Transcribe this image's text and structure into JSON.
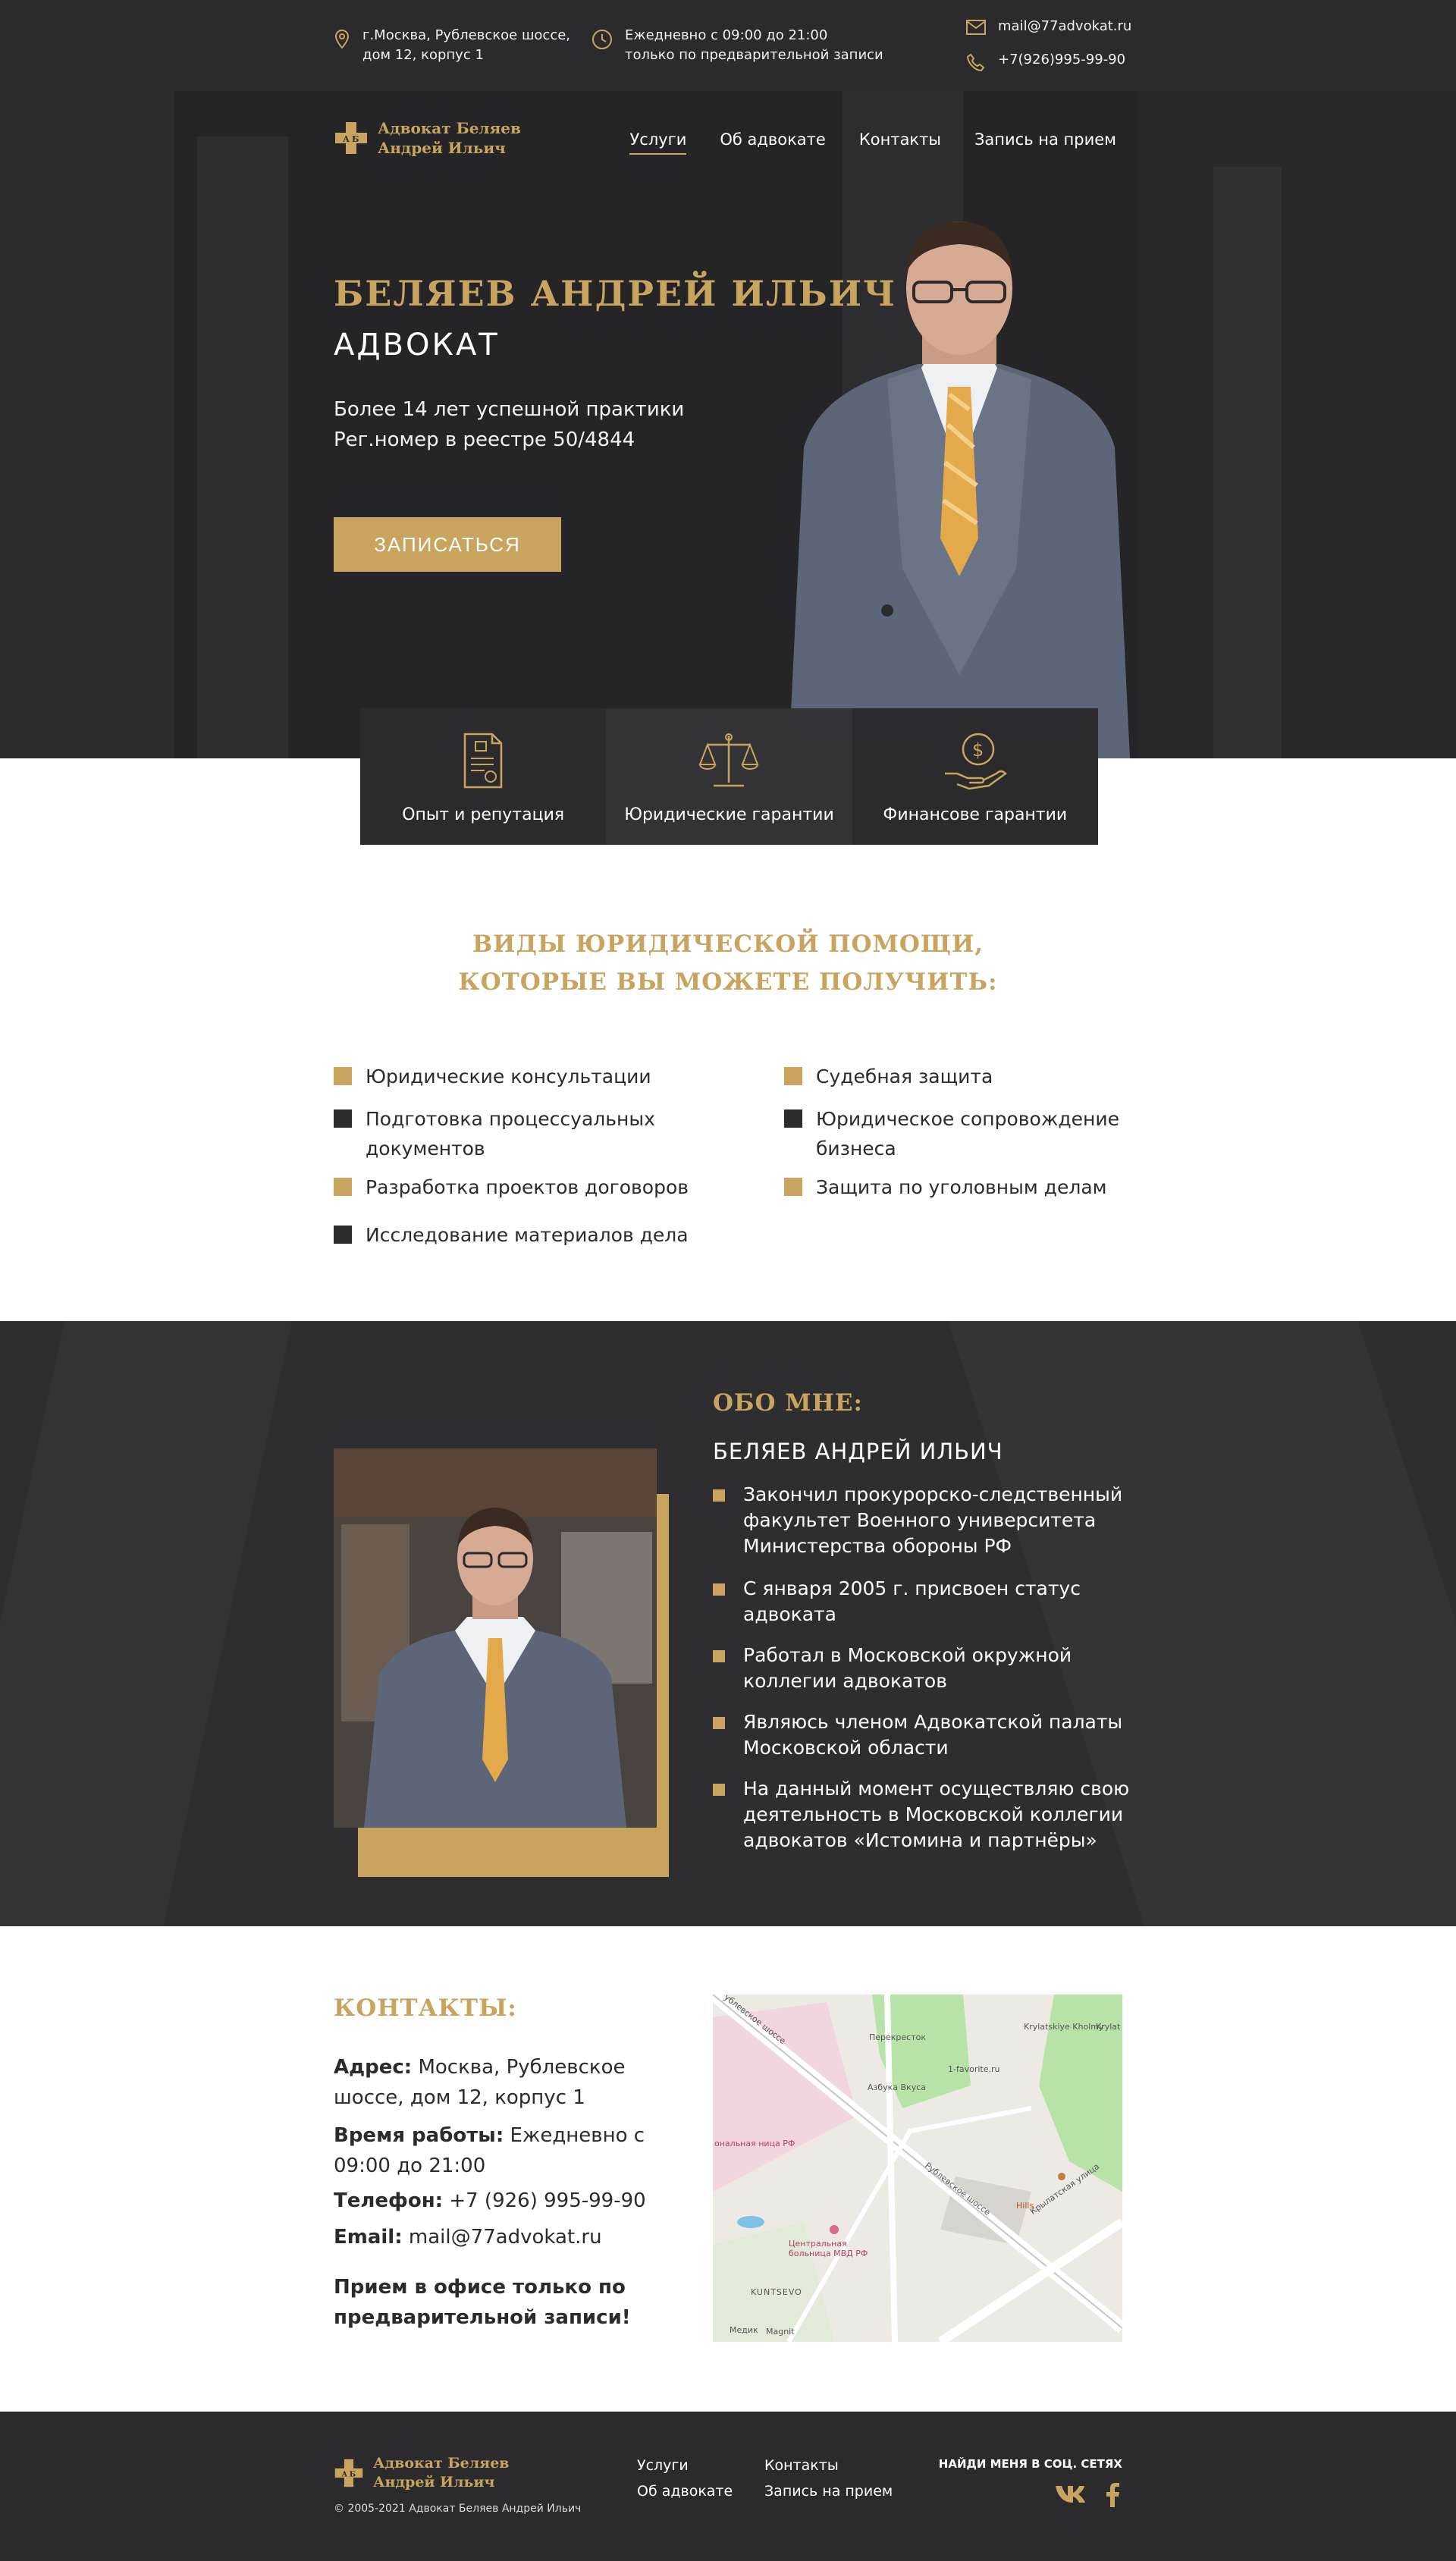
{
  "topbar": {
    "address_line1": "г.Москва, Рублевское шоссе,",
    "address_line2": "дом 12, корпус 1",
    "hours_line1": "Ежедневно с 09:00 до 21:00",
    "hours_line2": "только по предварительной записи",
    "email": "mail@77advokat.ru",
    "phone": "+7(926)995-99-90"
  },
  "brand": {
    "line1": "Адвокат Беляев",
    "line2": "Андрей Ильич",
    "logo_letters": "А Б"
  },
  "nav": [
    {
      "label": "Услуги",
      "active": true
    },
    {
      "label": "Об адвокате"
    },
    {
      "label": "Контакты"
    },
    {
      "label": "Запись на прием"
    }
  ],
  "hero": {
    "name": "БЕЛЯЕВ АНДРЕЙ ИЛЬИЧ",
    "role": "АДВОКАТ",
    "desc_line1": "Более 14 лет успешной практики",
    "desc_line2": "Рег.номер в реестре 50/4844",
    "cta": "ЗАПИСАТЬСЯ"
  },
  "features": [
    {
      "label": "Опыт и репутация",
      "icon": "certificate-icon"
    },
    {
      "label": "Юридические гарантии",
      "icon": "scales-icon"
    },
    {
      "label": "Финансове гарантии",
      "icon": "money-hand-icon"
    }
  ],
  "services": {
    "title_line1": "ВИДЫ ЮРИДИЧЕСКОЙ ПОМОЩИ,",
    "title_line2": "КОТОРЫЕ ВЫ МОЖЕТЕ ПОЛУЧИТЬ:",
    "left": [
      {
        "label": "Юридические консультации",
        "color": "#c9a45e"
      },
      {
        "label": "Подготовка процессуальных документов",
        "color": "#2b2b2d"
      },
      {
        "label": "Разработка проектов договоров",
        "color": "#c9a45e"
      },
      {
        "label": "Исследование материалов дела",
        "color": "#2b2b2d"
      }
    ],
    "right": [
      {
        "label": "Судебная защита",
        "color": "#c9a45e"
      },
      {
        "label": "Юридическое сопровождение бизнеса",
        "color": "#2b2b2d"
      },
      {
        "label": "Защита по уголовным делам",
        "color": "#c9a45e"
      }
    ]
  },
  "about": {
    "title": "ОБО МНЕ:",
    "name": "БЕЛЯЕВ АНДРЕЙ ИЛЬИЧ",
    "items": [
      "Закончил прокурорско-следственный факультет Военного университета Министерства обороны РФ",
      "С января 2005 г. присвоен статус адвоката",
      "Работал в Московской окружной коллегии адвокатов",
      "Являюсь членом Адвокатской палаты Московской области",
      "На данный момент осуществляю свою деятельность в Московской коллегии адвокатов «Истомина и партнёры»"
    ]
  },
  "contacts": {
    "title": "КОНТАКТЫ:",
    "address_label": "Адрес:",
    "address_value": "Москва, Рублевское шоссе, дом 12, корпус 1",
    "hours_label": "Время работы:",
    "hours_value": "Ежедневно с 09:00 до 21:00",
    "phone_label": "Телефон:",
    "phone_value": "+7 (926) 995-99-90",
    "email_label": "Email:",
    "email_value": "mail@77advokat.ru",
    "note": "Прием в офисе только по предварительной записи!"
  },
  "map": {
    "labels": [
      "Перекресток",
      "Krylatskiye Kholmy",
      "Krylat Comple",
      "1-favorite.ru",
      "Азбука Вкуса",
      "Рублевское шоссе",
      "Крылатская улица",
      "Hills",
      "ональная ница РФ",
      "Центральная больница МВД РФ",
      "KUNTSEVO",
      "Медик",
      "Magnit",
      "ублевское шоссе"
    ]
  },
  "footer": {
    "nav_col1": [
      "Услуги",
      "Об адвокате"
    ],
    "nav_col2": [
      "Контакты",
      "Запись на прием"
    ],
    "social_title": "НАЙДИ МЕНЯ В СОЦ. СЕТЯХ",
    "copyright": "© 2005-2021 Адвокат Беляев Андрей Ильич"
  }
}
